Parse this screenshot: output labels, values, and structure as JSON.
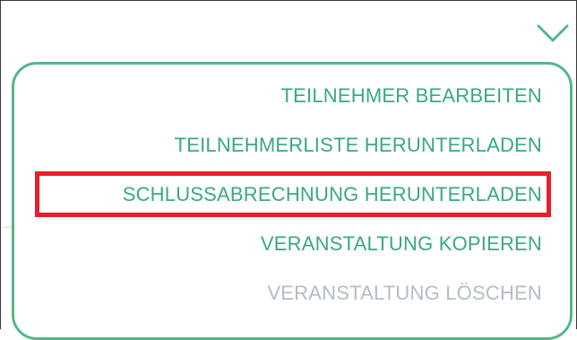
{
  "toggle": {
    "icon": "chevron-down-icon",
    "color": "#52b788"
  },
  "menu": {
    "border_color": "#52b788",
    "item_color": "#3aa883",
    "disabled_color": "#b4bcc6",
    "items": [
      {
        "label": "TEILNEHMER BEARBEITEN",
        "enabled": true
      },
      {
        "label": "TEILNEHMERLISTE HERUNTERLADEN",
        "enabled": true
      },
      {
        "label": "SCHLUSSABRECHNUNG HERUNTERLADEN",
        "enabled": true,
        "highlighted": true
      },
      {
        "label": "VERANSTALTUNG KOPIEREN",
        "enabled": true
      },
      {
        "label": "VERANSTALTUNG LÖSCHEN",
        "enabled": false
      }
    ]
  },
  "highlight": {
    "color": "#e5202b",
    "target": "SCHLUSSABRECHNUNG HERUNTERLADEN"
  }
}
